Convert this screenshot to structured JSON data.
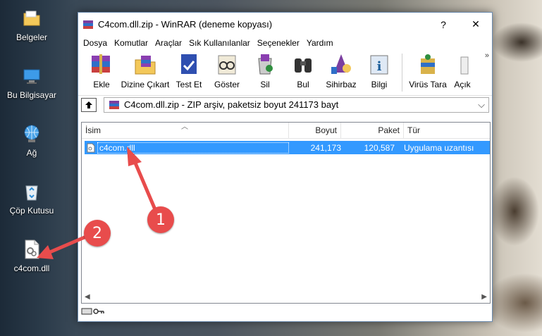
{
  "desktop": {
    "icons": [
      {
        "label": "Belgeler"
      },
      {
        "label": "Bu Bilgisayar"
      },
      {
        "label": "Ağ"
      },
      {
        "label": "Çöp Kutusu"
      },
      {
        "label": "c4com.dll"
      }
    ]
  },
  "window": {
    "title": "C4com.dll.zip - WinRAR (deneme kopyası)",
    "help_label": "?",
    "close_label": "✕"
  },
  "menu": [
    "Dosya",
    "Komutlar",
    "Araçlar",
    "Sık Kullanılanlar",
    "Seçenekler",
    "Yardım"
  ],
  "toolbar": {
    "buttons": [
      "Ekle",
      "Dizine Çıkart",
      "Test Et",
      "Göster",
      "Sil",
      "Bul",
      "Sihirbaz",
      "Bilgi",
      "Virüs Tara",
      "Açık"
    ],
    "more": "»"
  },
  "address": {
    "text": "C4com.dll.zip - ZIP arşiv, paketsiz boyut 241173 bayt",
    "dropdown": "⌵"
  },
  "list": {
    "columns": [
      "İsim",
      "Boyut",
      "Paket",
      "Tür"
    ],
    "rows": [
      {
        "name": "c4com.dll",
        "size": "241,173",
        "packed": "120,587",
        "type": "Uygulama uzantısı"
      }
    ]
  },
  "annotations": [
    "1",
    "2"
  ],
  "colors": {
    "selection": "#3399ff",
    "annotation": "#e84c4c",
    "accent_border": "#6c8cb0"
  }
}
